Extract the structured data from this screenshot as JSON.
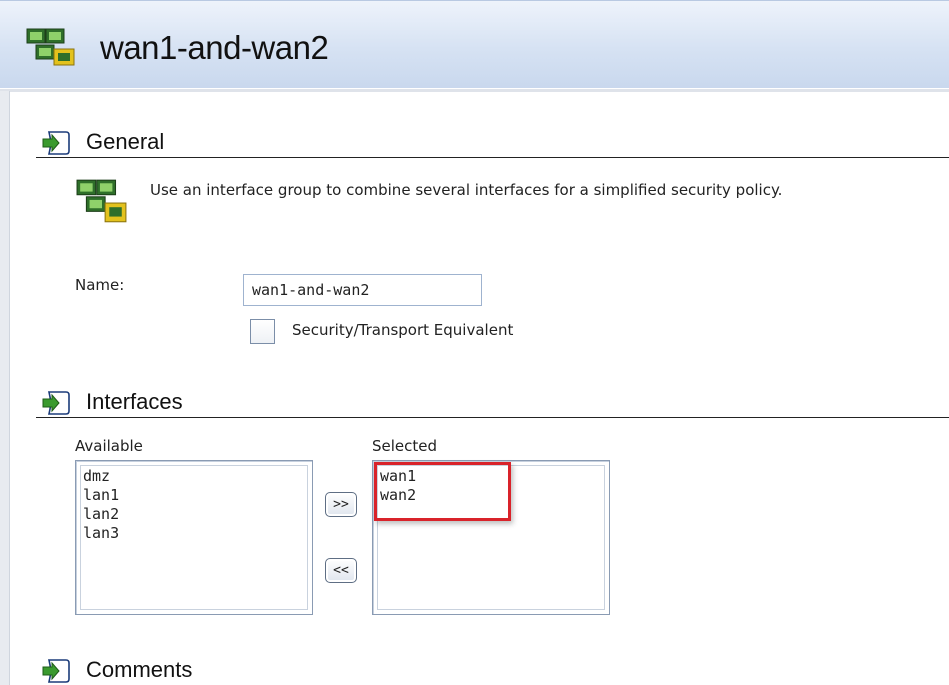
{
  "header": {
    "title": "wan1-and-wan2",
    "icon": "interface-group-icon"
  },
  "general": {
    "section_label": "General",
    "description": "Use an interface group to combine several interfaces for a simplified security policy.",
    "name_label": "Name:",
    "name_value": "wan1-and-wan2",
    "security_checkbox_label": "Security/Transport Equivalent",
    "security_checked": false
  },
  "interfaces": {
    "section_label": "Interfaces",
    "available_label": "Available",
    "available_items": [
      "dmz",
      "lan1",
      "lan2",
      "lan3"
    ],
    "selected_label": "Selected",
    "selected_items": [
      "wan1",
      "wan2"
    ],
    "add_button_label": ">>",
    "remove_button_label": "<<"
  },
  "comments": {
    "section_label": "Comments"
  },
  "colors": {
    "highlight": "#d9232a",
    "header_bg": "#d6e2f3",
    "arrow_green": "#3a9a2e"
  }
}
